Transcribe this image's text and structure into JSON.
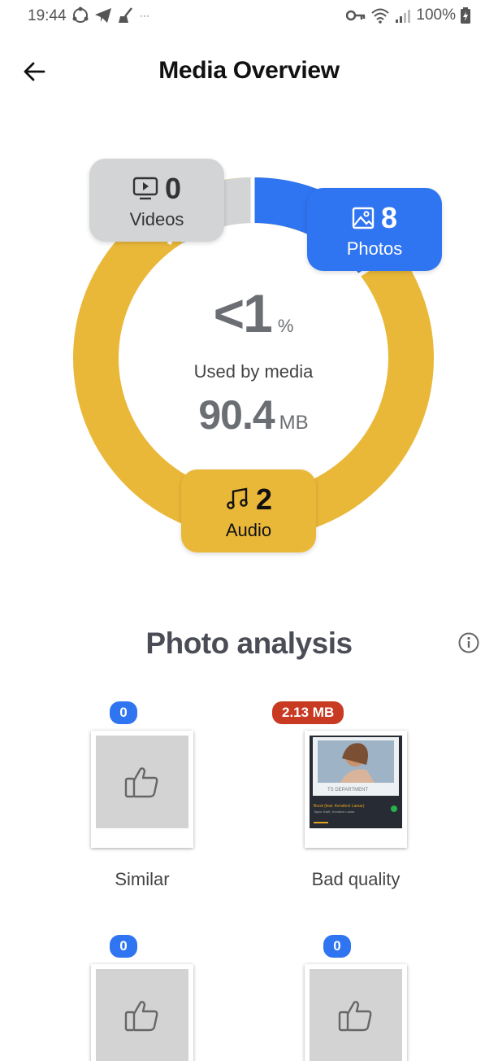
{
  "status": {
    "time": "19:44",
    "battery": "100%"
  },
  "header": {
    "title": "Media Overview"
  },
  "overview": {
    "percent": "<1",
    "percent_unit": "%",
    "used_label": "Used by media",
    "size_value": "90.4",
    "size_unit": "MB",
    "videos": {
      "count": "0",
      "label": "Videos"
    },
    "photos": {
      "count": "8",
      "label": "Photos"
    },
    "audio": {
      "count": "2",
      "label": "Audio"
    },
    "colors": {
      "videos": "#d2d4d6",
      "photos": "#2f74f0",
      "audio": "#eab839"
    }
  },
  "analysis": {
    "title": "Photo analysis",
    "tiles": [
      {
        "badge": "0",
        "label": "Similar",
        "icon": "thumbs-up-icon"
      },
      {
        "badge": "2.13 MB",
        "label": "Bad quality",
        "icon": "album-thumbnail",
        "thumb_text": "Bood (feat. Kendrick Lamar)",
        "thumb_sub": "Taylor Swift, Kendrick Lamar"
      },
      {
        "badge": "0",
        "label": "",
        "icon": "thumbs-up-icon"
      },
      {
        "badge": "0",
        "label": "",
        "icon": "thumbs-up-icon"
      }
    ]
  }
}
